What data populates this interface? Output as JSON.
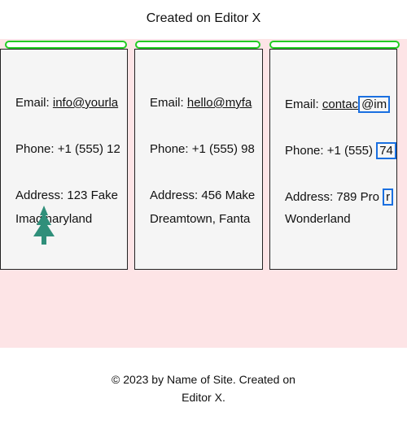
{
  "header": {
    "title": "Created on Editor X"
  },
  "cards": [
    {
      "email_label": "Email:",
      "email_value": "info@yourla",
      "phone_label": "Phone:",
      "phone_value": "+1 (555) 12",
      "address_label": "Address:",
      "address_line1": "123 Fake",
      "address_line2": "Imaginaryland"
    },
    {
      "email_label": "Email:",
      "email_value": "hello@myfa",
      "phone_label": "Phone:",
      "phone_value": "+1 (555) 98",
      "address_label": "Address:",
      "address_line1": "456 Make",
      "address_line2": "Dreamtown, Fanta"
    },
    {
      "email_label": "Email:",
      "email_value_pre": "contac",
      "email_value_framed": "@im",
      "phone_label": "Phone:",
      "phone_value_pre": "+1 (555)",
      "phone_value_framed": "74",
      "address_label": "Address:",
      "address_value_pre": "789 Pro",
      "address_value_framed": "r",
      "address_line2": "Wonderland"
    }
  ],
  "footer": {
    "line1": "© 2023 by Name of Site. Created on",
    "line2": "Editor X."
  },
  "colors": {
    "band": "#fde4e6",
    "card": "#f5f5f5",
    "highlight_green": "#22cc22",
    "highlight_blue": "#1a6fe0",
    "tree_icon": "#2f8f7a"
  },
  "icons": {
    "card1": "tree-icon"
  }
}
